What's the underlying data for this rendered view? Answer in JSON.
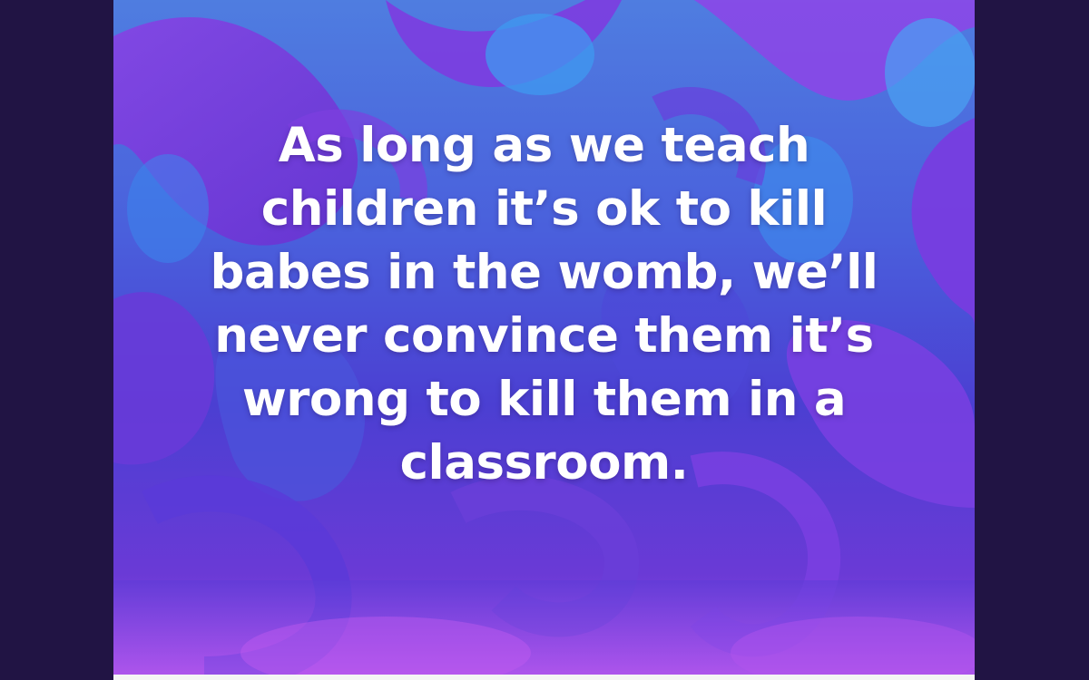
{
  "post": {
    "quote_lines": [
      "As long as we teach",
      "children it’s ok to kill",
      "babes in the womb, we’ll",
      "never convince them it’s",
      "wrong to kill them in a",
      "classroom."
    ]
  },
  "colors": {
    "outer_background": "#211444",
    "swirl_blue": "#3d8df0",
    "swirl_purple": "#7b3fe0",
    "swirl_violet": "#9a45e8",
    "text": "#ffffff"
  },
  "icons": {
    "background": "abstract-swirl-pattern"
  }
}
